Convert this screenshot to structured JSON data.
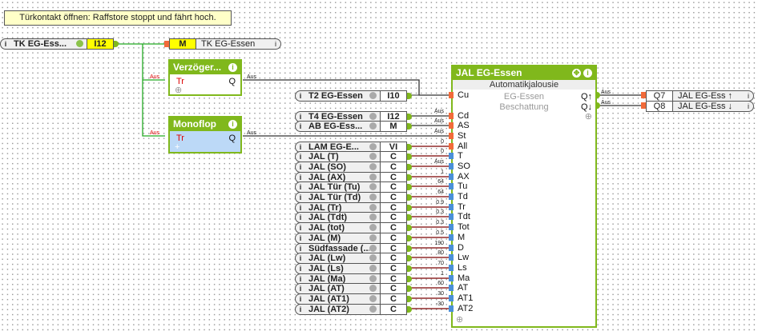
{
  "comment": "Türkontakt öffnen: Raffstore stoppt und fährt hoch.",
  "tk_input": {
    "name": "TK EG-Ess...",
    "type": "I12"
  },
  "tk_marker": {
    "type": "M",
    "name": "TK EG-Essen"
  },
  "delay_block": {
    "title": "Verzöger...",
    "input": "Tr",
    "output": "Q",
    "in_value": "Aus",
    "out_value": "Aus"
  },
  "monoflop_block": {
    "title": "Monoflop",
    "input": "Tr",
    "output": "Q",
    "in_value": "Aus",
    "out_value": "Aus"
  },
  "jal_block": {
    "title": "JAL EG-Essen",
    "subtitle": "Automatikjalousie",
    "room": "EG-Essen",
    "category": "Beschattung",
    "out_up": "Q↑",
    "out_down": "Q↓",
    "out_up_value": "Aus",
    "out_down_value": "Aus"
  },
  "digital_inputs": [
    {
      "name": "T2 EG-Essen",
      "type": "I10",
      "pin": "Cu",
      "value": ""
    },
    {
      "name": "T4 EG-Essen",
      "type": "I12",
      "pin": "Cd",
      "value": "Aus"
    },
    {
      "name": "AB EG-Ess...",
      "type": "M",
      "pin": "AS",
      "value": "Aus"
    }
  ],
  "st_pin": {
    "pin": "St",
    "value": "Aus"
  },
  "analog_inputs": [
    {
      "name": "LAM EG-E...",
      "type": "VI",
      "pin": "All",
      "value": "0"
    },
    {
      "name": "JAL (T)",
      "type": "C",
      "pin": "T",
      "value": "0"
    },
    {
      "name": "JAL (SO)",
      "type": "C",
      "pin": "SO",
      "value": "Aus"
    },
    {
      "name": "JAL (AX)",
      "type": "C",
      "pin": "AX",
      "value": "1"
    },
    {
      "name": "JAL Tür (Tu)",
      "type": "C",
      "pin": "Tu",
      "value": "64"
    },
    {
      "name": "JAL Tür (Td)",
      "type": "C",
      "pin": "Td",
      "value": "64"
    },
    {
      "name": "JAL (Tr)",
      "type": "C",
      "pin": "Tr",
      "value": "0.9"
    },
    {
      "name": "JAL (Tdt)",
      "type": "C",
      "pin": "Tdt",
      "value": "0.3"
    },
    {
      "name": "JAL (tot)",
      "type": "C",
      "pin": "Tot",
      "value": "0.3"
    },
    {
      "name": "JAL (M)",
      "type": "C",
      "pin": "M",
      "value": "0.5"
    },
    {
      "name": "Südfassade (...",
      "type": "C",
      "pin": "D",
      "value": "190"
    },
    {
      "name": "JAL (Lw)",
      "type": "C",
      "pin": "Lw",
      "value": "80"
    },
    {
      "name": "JAL (Ls)",
      "type": "C",
      "pin": "Ls",
      "value": "70"
    },
    {
      "name": "JAL (Ma)",
      "type": "C",
      "pin": "Ma",
      "value": "1"
    },
    {
      "name": "JAL (AT)",
      "type": "C",
      "pin": "AT",
      "value": "60"
    },
    {
      "name": "JAL (AT1)",
      "type": "C",
      "pin": "AT1",
      "value": "30"
    },
    {
      "name": "JAL (AT2)",
      "type": "C",
      "pin": "AT2",
      "value": "-30"
    }
  ],
  "outputs": [
    {
      "type": "Q7",
      "name": "JAL EG-Ess ↑"
    },
    {
      "type": "Q8",
      "name": "JAL EG-Ess ↓"
    }
  ],
  "colors": {
    "green": "#80b81c",
    "wire_digital": "#333333",
    "wire_analog": "#7a0000",
    "pin_digital": "#f26b3a",
    "pin_analog": "#4a90d9"
  }
}
